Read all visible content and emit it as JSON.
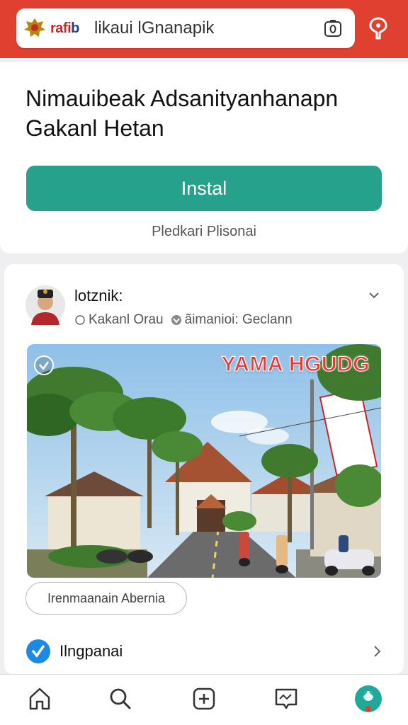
{
  "header": {
    "logo_text_red": "rafi",
    "logo_text_blue": "b",
    "search_text": "likaui lGnanapik",
    "icons": {
      "emblem": "garuda-emblem-icon",
      "camera": "camera-icon",
      "pin": "location-pin-icon"
    },
    "color": "#e0402f"
  },
  "promo": {
    "title": "Nimauibeak Adsanityanhanapn Gakanl Hetan",
    "install_label": "Instal",
    "subtitle": "Pledkari Plisonai",
    "button_color": "#26a18c"
  },
  "post": {
    "author": "lotznik:",
    "meta_left": "Kakanl Orau",
    "meta_right": "ãimanioi: Geclann",
    "photo_title": "YAMA HGUDG",
    "tag_label": "Irenmaanain Abernia",
    "row_label": "Ilngpanai",
    "icons": {
      "avatar": "avatar",
      "location": "location-icon",
      "group": "group-icon",
      "expand": "chevron-down-icon",
      "badge": "leaf-badge-icon",
      "row": "verified-icon",
      "row_chevron": "chevron-right-icon"
    }
  },
  "nav": {
    "items": [
      "home-icon",
      "search-icon",
      "add-icon",
      "message-icon",
      "profile-icon"
    ]
  }
}
